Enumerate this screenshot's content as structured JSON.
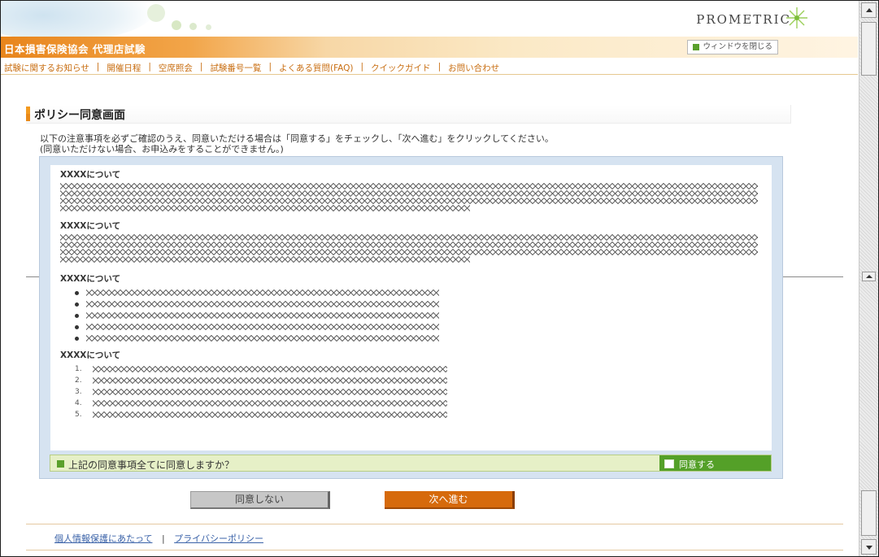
{
  "header": {
    "brand_logo_text": "PROMETRIC",
    "site_title": "日本損害保険協会 代理店試験",
    "close_window_label": "ウィンドウを閉じる"
  },
  "nav": {
    "items": [
      {
        "label": "試験に関するお知らせ"
      },
      {
        "label": "開催日程"
      },
      {
        "label": "空席照会"
      },
      {
        "label": "試験番号一覧"
      },
      {
        "label": "よくある質問(FAQ)"
      },
      {
        "label": "クイックガイド"
      },
      {
        "label": "お問い合わせ"
      }
    ],
    "separator": "|"
  },
  "main": {
    "heading": "ポリシー同意画面",
    "instruction_line1": "以下の注意事項を必ずご確認のうえ、同意いただける場合は「同意する」をチェックし、「次へ進む」をクリックしてください。",
    "instruction_line2": "(同意いただけない場合、お申込みをすることができません。)"
  },
  "policy": {
    "section1_heading": "XXXXについて",
    "section2_heading": "XXXXについて",
    "section3_heading": "XXXXについて",
    "section4_heading": "XXXXについて",
    "section3_items_count": 5,
    "section4_numbers": [
      "1.",
      "2.",
      "3.",
      "4.",
      "5."
    ]
  },
  "agreement": {
    "question": "上記の同意事項全てに同意しますか？",
    "checkbox_label": "同意する",
    "checked": false
  },
  "buttons": {
    "disagree_label": "同意しない",
    "next_label": "次へ進む"
  },
  "footer": {
    "privacy_protection_link": "個人情報保護にあたって",
    "separator": "|",
    "privacy_policy_link": "プライバシーポリシー"
  },
  "colors": {
    "accent_orange": "#e8851c",
    "agree_green": "#54a028",
    "next_button": "#d66a0c",
    "link_blue": "#3a62a8"
  }
}
